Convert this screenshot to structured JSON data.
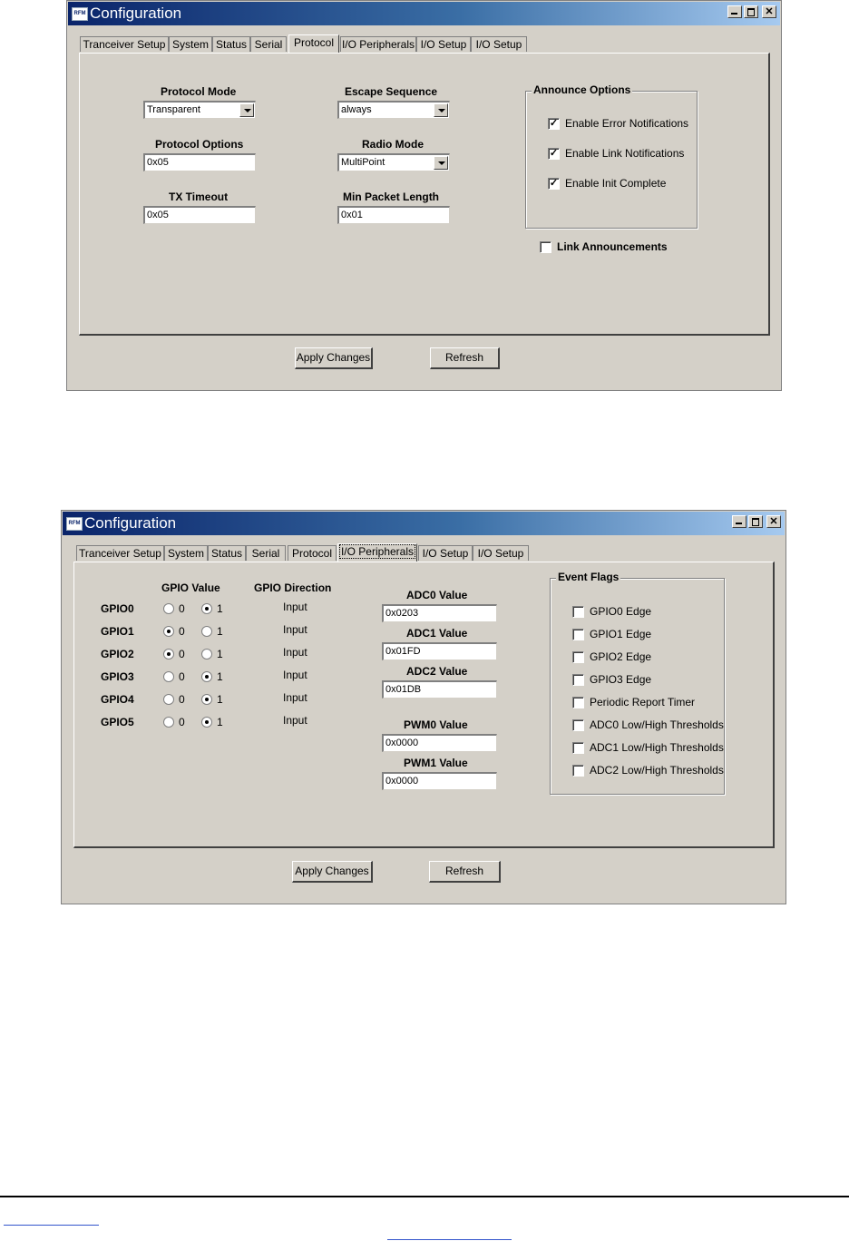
{
  "window1": {
    "title": "Configuration",
    "icon_label": "RFM",
    "tabs": [
      {
        "label": "Tranceiver Setup"
      },
      {
        "label": "System"
      },
      {
        "label": "Status"
      },
      {
        "label": "Serial"
      },
      {
        "label": "Protocol",
        "active": true
      },
      {
        "label": "I/O Peripherals"
      },
      {
        "label": "I/O Setup"
      },
      {
        "label": "I/O Setup"
      }
    ],
    "protocol_mode": {
      "label": "Protocol Mode",
      "value": "Transparent"
    },
    "escape_sequence": {
      "label": "Escape Sequence",
      "value": "always"
    },
    "protocol_options": {
      "label": "Protocol Options",
      "value": "0x05"
    },
    "radio_mode": {
      "label": "Radio Mode",
      "value": "MultiPoint"
    },
    "tx_timeout": {
      "label": "TX Timeout",
      "value": "0x05"
    },
    "min_packet_length": {
      "label": "Min Packet Length",
      "value": "0x01"
    },
    "announce_options": {
      "title": "Announce Options",
      "items": [
        {
          "label": "Enable Error Notifications",
          "checked": true
        },
        {
          "label": "Enable Link Notifications",
          "checked": true
        },
        {
          "label": "Enable Init Complete",
          "checked": true
        }
      ]
    },
    "link_announcements": {
      "label": "Link Announcements",
      "checked": false
    },
    "apply_label": "Apply Changes",
    "refresh_label": "Refresh"
  },
  "window2": {
    "title": "Configuration",
    "icon_label": "RFM",
    "tabs": [
      {
        "label": "Tranceiver Setup"
      },
      {
        "label": "System"
      },
      {
        "label": "Status"
      },
      {
        "label": "Serial"
      },
      {
        "label": "Protocol"
      },
      {
        "label": "I/O Peripherals",
        "active": true
      },
      {
        "label": "I/O Setup"
      },
      {
        "label": "I/O Setup"
      }
    ],
    "gpio_value_header": "GPIO Value",
    "gpio_direction_header": "GPIO Direction",
    "radio_zero": "0",
    "radio_one": "1",
    "gpios": [
      {
        "name": "GPIO0",
        "value": 1,
        "direction": "Input"
      },
      {
        "name": "GPIO1",
        "value": 0,
        "direction": "Input"
      },
      {
        "name": "GPIO2",
        "value": 0,
        "direction": "Input"
      },
      {
        "name": "GPIO3",
        "value": 1,
        "direction": "Input"
      },
      {
        "name": "GPIO4",
        "value": 1,
        "direction": "Input"
      },
      {
        "name": "GPIO5",
        "value": 1,
        "direction": "Input"
      }
    ],
    "adc0": {
      "label": "ADC0 Value",
      "value": "0x0203"
    },
    "adc1": {
      "label": "ADC1 Value",
      "value": "0x01FD"
    },
    "adc2": {
      "label": "ADC2 Value",
      "value": "0x01DB"
    },
    "pwm0": {
      "label": "PWM0 Value",
      "value": "0x0000"
    },
    "pwm1": {
      "label": "PWM1 Value",
      "value": "0x0000"
    },
    "event_flags": {
      "title": "Event Flags",
      "items": [
        {
          "label": "GPIO0 Edge",
          "checked": false
        },
        {
          "label": "GPIO1 Edge",
          "checked": false
        },
        {
          "label": "GPIO2 Edge",
          "checked": false
        },
        {
          "label": "GPIO3 Edge",
          "checked": false
        },
        {
          "label": "Periodic Report Timer",
          "checked": false
        },
        {
          "label": "ADC0 Low/High Thresholds",
          "checked": false
        },
        {
          "label": "ADC1 Low/High Thresholds",
          "checked": false
        },
        {
          "label": "ADC2 Low/High Thresholds",
          "checked": false
        }
      ]
    },
    "apply_label": "Apply Changes",
    "refresh_label": "Refresh"
  },
  "colors": {
    "title_start": "#0a246a",
    "title_end": "#a6caf0",
    "face": "#d4d0c8"
  }
}
